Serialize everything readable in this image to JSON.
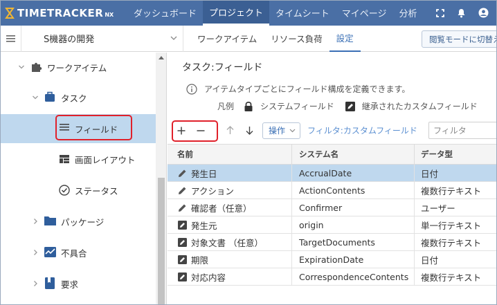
{
  "app": {
    "logo_text": "TIMETRACKER",
    "logo_suffix": "NX"
  },
  "nav": {
    "items": [
      {
        "label": "ダッシュボード"
      },
      {
        "label": "プロジェクト"
      },
      {
        "label": "タイムシート"
      },
      {
        "label": "マイページ"
      },
      {
        "label": "分析"
      }
    ],
    "active_index": 1
  },
  "project": {
    "name": "S機器の開発"
  },
  "subtabs": [
    {
      "label": "ワークアイテム"
    },
    {
      "label": "リソース負荷"
    },
    {
      "label": "設定"
    }
  ],
  "mode_button": "閲覧モードに切替え",
  "tree": [
    {
      "label": "ワークアイテム",
      "icon": "puzzle-icon"
    },
    {
      "label": "タスク",
      "icon": "briefcase-icon"
    },
    {
      "label": "フィールド",
      "icon": "list-icon"
    },
    {
      "label": "画面レイアウト",
      "icon": "layout-icon"
    },
    {
      "label": "ステータス",
      "icon": "check-circle-icon"
    },
    {
      "label": "パッケージ",
      "icon": "folder-icon"
    },
    {
      "label": "不具合",
      "icon": "chart-icon"
    },
    {
      "label": "要求",
      "icon": "book-icon"
    }
  ],
  "main": {
    "title": "タスク:フィールド",
    "info": "アイテムタイプごとにフィールド構成を定義できます。",
    "legend_label": "凡例",
    "legend_system": "システムフィールド",
    "legend_inherited": "継承されたカスタムフィールド"
  },
  "toolbar": {
    "operation": "操作",
    "filter_link": "フィルタ:カスタムフィールド",
    "filter_placeholder": "フィルタ"
  },
  "grid": {
    "columns": [
      "名前",
      "システム名",
      "データ型"
    ],
    "rows": [
      {
        "name": "発生日",
        "system": "AccrualDate",
        "type": "日付",
        "icon": "pencil-icon"
      },
      {
        "name": "アクション",
        "system": "ActionContents",
        "type": "複数行テキスト",
        "icon": "pencil-icon"
      },
      {
        "name": "確認者（任意）",
        "system": "Confirmer",
        "type": "ユーザー",
        "icon": "pencil-icon"
      },
      {
        "name": "発生元",
        "system": "origin",
        "type": "単一行テキスト",
        "icon": "edit-box-icon"
      },
      {
        "name": "対象文書 （任意）",
        "system": "TargetDocuments",
        "type": "複数行テキスト",
        "icon": "edit-box-icon"
      },
      {
        "name": "期限",
        "system": "ExpirationDate",
        "type": "日付",
        "icon": "edit-box-icon"
      },
      {
        "name": "対応内容",
        "system": "CorrespondenceContents",
        "type": "複数行テキスト",
        "icon": "edit-box-icon"
      }
    ]
  },
  "colors": {
    "topbar": "#4a6fa5",
    "accent": "#3a6fb5",
    "selected": "#bfd8ee",
    "highlight": "#e0202a"
  }
}
